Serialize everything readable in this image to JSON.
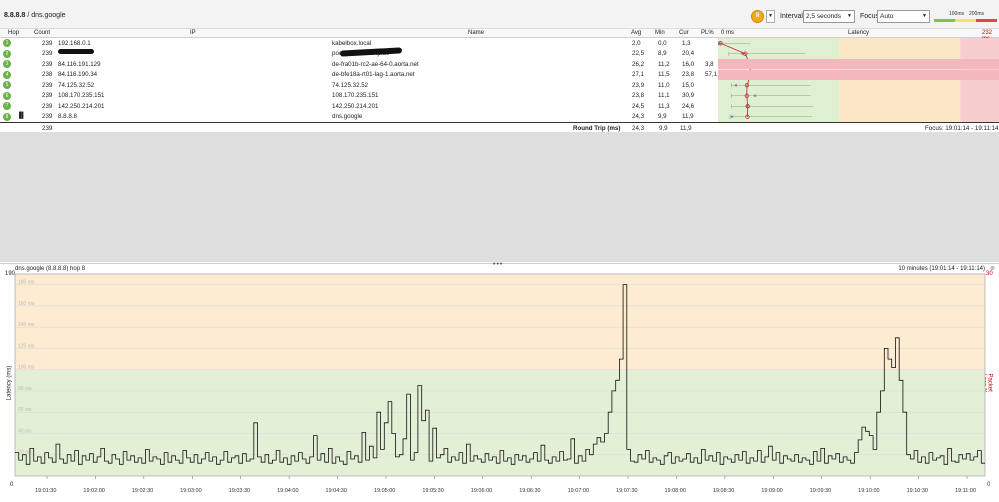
{
  "header": {
    "host_ip": "8.8.8.8",
    "host_sep": " / ",
    "host_name": "dns.google",
    "pause_icon": "pause-icon",
    "interval_label": "Interval",
    "interval_value": "2,5 seconds",
    "focus_label": "Focus",
    "focus_value": "Auto",
    "legend": {
      "t1": "100ms",
      "t2": "200ms"
    },
    "colors": {
      "green": "#78c850",
      "yellow": "#f2e36b",
      "red": "#e8424c",
      "pause": "#f4a81d"
    }
  },
  "table": {
    "columns": {
      "hop": "Hop",
      "count": "Count",
      "ip": "IP",
      "name": "Name",
      "avg": "Avg",
      "min": "Min",
      "cur": "Cur",
      "pl": "PL%",
      "zero": "0 ms",
      "latency": "Latency",
      "max": "232 ms"
    },
    "rows": [
      {
        "hop": "1",
        "count": "239",
        "ip": "192.168.0.1",
        "name": "kabelbox.local",
        "avg": "2,0",
        "min": "0,0",
        "cur": "1,3",
        "pl": ""
      },
      {
        "hop": "2",
        "count": "239",
        "ip": "",
        "name": "pools.vodafone-ip.de",
        "avg": "22,5",
        "min": "8,9",
        "cur": "20,4",
        "pl": ""
      },
      {
        "hop": "3",
        "count": "239",
        "ip": "84.116.191.129",
        "name": "de-fra01b-rc2-ae-64-0.aorta.net",
        "avg": "26,2",
        "min": "11,2",
        "cur": "16,0",
        "pl": "3,8"
      },
      {
        "hop": "4",
        "count": "238",
        "ip": "84.116.190.34",
        "name": "de-bfe18a-rt01-lag-1.aorta.net",
        "avg": "27,1",
        "min": "11,5",
        "cur": "23,8",
        "pl": "57,1"
      },
      {
        "hop": "5",
        "count": "239",
        "ip": "74.125.32.52",
        "name": "74.125.32.52",
        "avg": "23,9",
        "min": "11,0",
        "cur": "15,0",
        "pl": ""
      },
      {
        "hop": "6",
        "count": "239",
        "ip": "108.170.235.151",
        "name": "108.170.235.151",
        "avg": "23,8",
        "min": "11,1",
        "cur": "30,9",
        "pl": ""
      },
      {
        "hop": "7",
        "count": "239",
        "ip": "142.250.214.201",
        "name": "142.250.214.201",
        "avg": "24,5",
        "min": "11,3",
        "cur": "24,6",
        "pl": ""
      },
      {
        "hop": "8",
        "count": "239",
        "ip": "8.8.8.8",
        "name": "dns.google",
        "avg": "24,3",
        "min": "9,9",
        "cur": "11,9",
        "pl": ""
      }
    ],
    "summary": {
      "count": "239",
      "label": "Round Trip (ms)",
      "avg": "24,3",
      "min": "9,9",
      "cur": "11,9",
      "focus": "Focus: 19:01:14 - 19:11:14"
    }
  },
  "chart_header": {
    "title": "dns.google (8.8.8.8) hop 8",
    "range": "10 minutes (19:01:14 - 19:11:14)",
    "ylabel": "Latency (ms)",
    "y2label": "Packet Loss %",
    "ymax": "190",
    "ymin": "0",
    "y2max": "30",
    "y2min": "0"
  },
  "chart_data": {
    "type": "line",
    "ylabel": "Latency (ms)",
    "y2label": "Packet Loss %",
    "ylim": [
      0,
      190
    ],
    "y2lim": [
      0,
      30
    ],
    "yticks": [
      20,
      40,
      60,
      80,
      100,
      120,
      140,
      160,
      180
    ],
    "xticks": [
      "19:01:30",
      "19:02:00",
      "19:02:30",
      "19:03:00",
      "19:03:30",
      "19:04:00",
      "19:04:30",
      "19:05:00",
      "19:05:30",
      "19:06:00",
      "19:06:30",
      "19:07:00",
      "19:07:30",
      "19:08:00",
      "19:08:30",
      "19:09:00",
      "19:09:30",
      "19:10:00",
      "19:10:30",
      "19:11:00"
    ],
    "bands": {
      "green_max": 100,
      "yellow_max": 190
    },
    "series": [
      {
        "values": [
          22,
          15,
          20,
          11,
          26,
          14,
          18,
          12,
          22,
          17,
          13,
          30,
          16,
          12,
          20,
          14,
          24,
          11,
          19,
          15,
          21,
          13,
          18,
          26,
          14,
          12,
          20,
          16,
          11,
          23,
          15,
          19,
          13,
          17,
          12,
          25,
          14,
          18,
          16,
          11,
          22,
          13,
          19,
          15,
          12,
          24,
          17,
          13,
          20,
          12,
          16,
          22,
          14,
          18,
          11,
          15,
          23,
          13,
          17,
          19,
          12,
          21,
          14,
          16,
          50,
          18,
          13,
          20,
          12,
          15,
          24,
          13,
          17,
          11,
          19,
          14,
          22,
          16,
          12,
          18,
          38,
          15,
          21,
          13,
          26,
          12,
          18,
          14,
          11,
          23,
          16,
          19,
          13,
          41,
          15,
          28,
          17,
          60,
          25,
          50,
          70,
          40,
          18,
          20,
          35,
          77,
          15,
          22,
          85,
          52,
          62,
          14,
          45,
          17,
          20,
          26,
          13,
          18,
          15,
          22,
          12,
          30,
          14,
          19,
          16,
          13,
          21,
          15,
          18,
          12,
          24,
          14,
          17,
          11,
          20,
          15,
          19,
          13,
          16,
          22,
          14,
          29,
          15,
          12,
          18,
          14,
          23,
          15,
          16,
          35,
          12,
          19,
          14,
          25,
          20,
          30,
          36,
          32,
          40,
          60,
          80,
          90,
          110,
          180,
          25,
          14,
          13,
          20,
          16,
          24,
          13,
          17,
          15,
          11,
          19,
          22,
          12,
          18,
          14,
          16,
          21,
          13,
          17,
          12,
          25,
          15,
          19,
          14,
          22,
          11,
          18,
          16,
          13,
          20,
          15,
          23,
          12,
          17,
          14,
          24,
          13,
          18,
          28,
          15,
          22,
          12,
          19,
          16,
          14,
          20,
          13,
          17,
          15,
          11,
          23,
          14,
          26,
          12,
          19,
          16,
          21,
          13,
          18,
          15,
          12,
          22,
          34,
          46,
          42,
          38,
          25,
          60,
          80,
          120,
          110,
          102,
          130,
          90,
          60,
          20,
          16,
          24,
          13,
          18,
          12,
          22,
          15,
          17,
          19,
          11,
          26,
          14,
          13,
          20,
          16,
          21,
          15,
          18,
          24,
          12
        ]
      }
    ]
  }
}
